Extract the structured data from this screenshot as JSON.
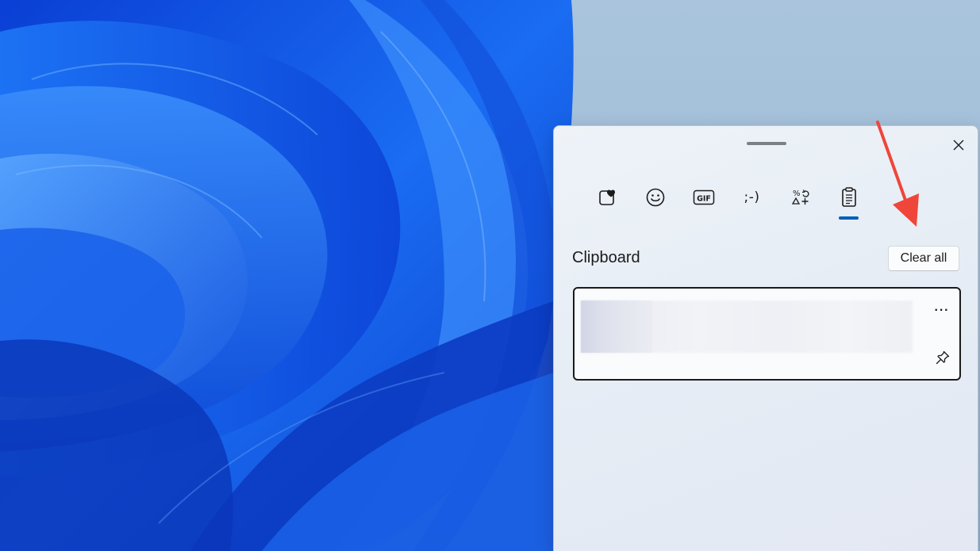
{
  "panel": {
    "tabs": [
      {
        "name": "favorites",
        "icon": "heart-sticker-icon",
        "active": false
      },
      {
        "name": "emoji",
        "icon": "smiley-icon",
        "active": false
      },
      {
        "name": "gif",
        "icon": "gif-icon",
        "label": "GIF",
        "active": false
      },
      {
        "name": "kaomoji",
        "icon": "kaomoji-icon",
        "label": ";-)",
        "active": false
      },
      {
        "name": "symbols",
        "icon": "symbols-icon",
        "active": false
      },
      {
        "name": "clipboard",
        "icon": "clipboard-icon",
        "active": true
      }
    ],
    "section_title": "Clipboard",
    "clear_all_label": "Clear all",
    "more_label": "···"
  },
  "colors": {
    "accent": "#005fb8",
    "annotation_arrow": "#f0453a",
    "text": "#1b1b1b"
  }
}
